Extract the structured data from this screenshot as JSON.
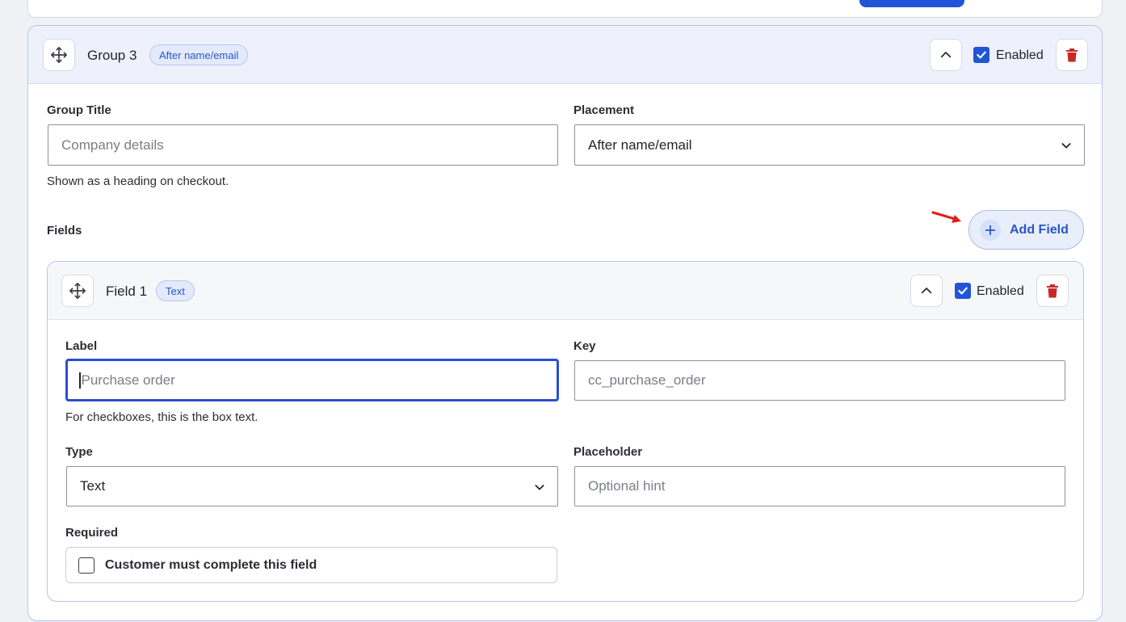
{
  "group": {
    "title": "Group 3",
    "placement_badge": "After name/email",
    "enabled_label": "Enabled",
    "enabled": true,
    "group_title_label": "Group Title",
    "group_title_placeholder": "Company details",
    "group_title_help": "Shown as a heading on checkout.",
    "placement_label": "Placement",
    "placement_value": "After name/email",
    "fields_label": "Fields",
    "add_field_label": "Add Field"
  },
  "field": {
    "title": "Field 1",
    "type_badge": "Text",
    "enabled_label": "Enabled",
    "enabled": true,
    "label_label": "Label",
    "label_placeholder": "Purchase order",
    "label_help": "For checkboxes, this is the box text.",
    "key_label": "Key",
    "key_placeholder": "cc_purchase_order",
    "type_label": "Type",
    "type_value": "Text",
    "placeholder_label": "Placeholder",
    "placeholder_placeholder": "Optional hint",
    "required_label": "Required",
    "required_text": "Customer must complete this field",
    "required_checked": false
  },
  "icons": {
    "drag": "move-icon",
    "collapse": "chevron-up-icon",
    "delete": "trash-icon",
    "add": "plus-icon",
    "dropdown": "chevron-down-icon"
  },
  "colors": {
    "accent": "#2155d6",
    "delete": "#c62828",
    "annotation_arrow": "#e0201b"
  }
}
